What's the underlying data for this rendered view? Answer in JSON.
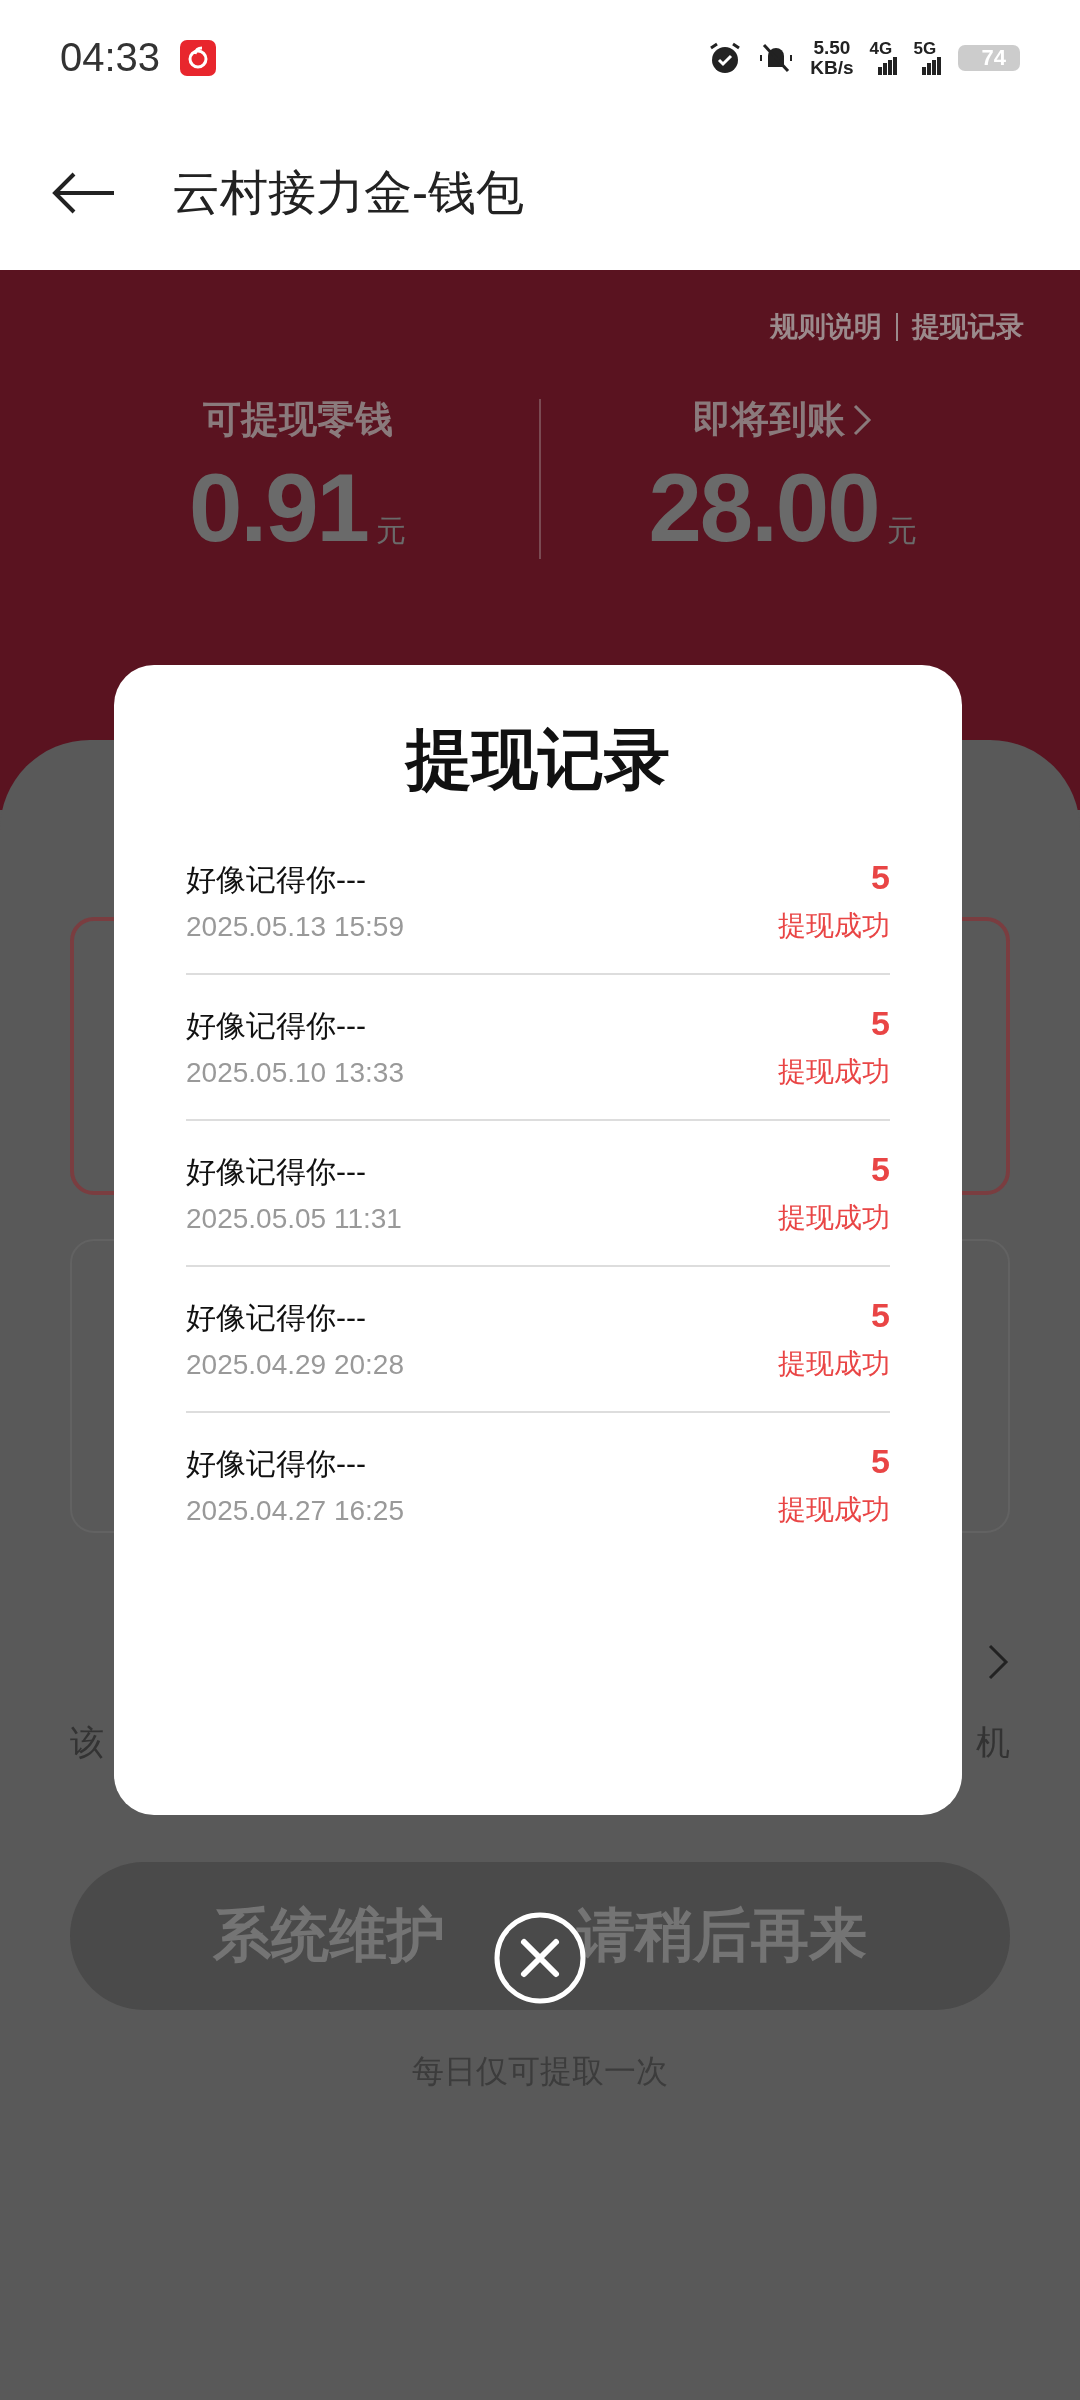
{
  "status_bar": {
    "time": "04:33",
    "net_speed": "5.50",
    "net_unit": "KB/s",
    "networks": [
      "4G",
      "5G"
    ],
    "battery": "74"
  },
  "app_bar": {
    "title": "云村接力金-钱包"
  },
  "header": {
    "links": [
      "规则说明",
      "提现记录"
    ],
    "balances": [
      {
        "label": "可提现零钱",
        "amount": "0.91",
        "unit": "元",
        "has_chevron": false
      },
      {
        "label": "即将到账",
        "amount": "28.00",
        "unit": "元",
        "has_chevron": true
      }
    ]
  },
  "sheet": {
    "desc_fragments": [
      "该",
      "机"
    ],
    "button_parts": [
      "系统维护",
      "请稍后再来"
    ],
    "note": "每日仅可提取一次"
  },
  "dialog": {
    "title": "提现记录",
    "records": [
      {
        "name": "好像记得你---",
        "time": "2025.05.13 15:59",
        "amount": "5",
        "status": "提现成功"
      },
      {
        "name": "好像记得你---",
        "time": "2025.05.10 13:33",
        "amount": "5",
        "status": "提现成功"
      },
      {
        "name": "好像记得你---",
        "time": "2025.05.05 11:31",
        "amount": "5",
        "status": "提现成功"
      },
      {
        "name": "好像记得你---",
        "time": "2025.04.29 20:28",
        "amount": "5",
        "status": "提现成功"
      },
      {
        "name": "好像记得你---",
        "time": "2025.04.27 16:25",
        "amount": "5",
        "status": "提现成功"
      }
    ]
  }
}
